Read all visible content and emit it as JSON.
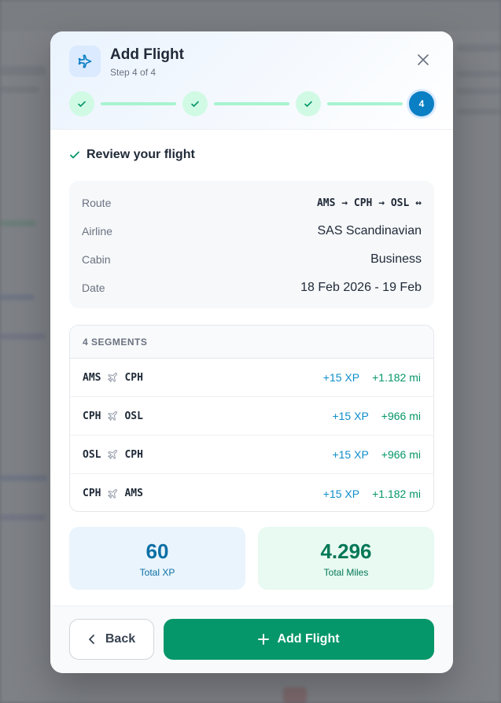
{
  "colors": {
    "accent": "#0b7fc4",
    "success": "#059669",
    "xp": "#0e8ec9"
  },
  "modal": {
    "title": "Add Flight",
    "step_label": "Step 4 of 4",
    "current_step": "4"
  },
  "review": {
    "heading": "Review your flight",
    "route_label": "Route",
    "route_value": "AMS → CPH → OSL ↔",
    "airline_label": "Airline",
    "airline_value": "SAS Scandinavian",
    "cabin_label": "Cabin",
    "cabin_value": "Business",
    "date_label": "Date",
    "date_value": "18 Feb 2026 - 19 Feb"
  },
  "segments": {
    "header": "4 SEGMENTS",
    "rows": [
      {
        "from": "AMS",
        "to": "CPH",
        "xp": "+15 XP",
        "miles": "+1.182 mi"
      },
      {
        "from": "CPH",
        "to": "OSL",
        "xp": "+15 XP",
        "miles": "+966 mi"
      },
      {
        "from": "OSL",
        "to": "CPH",
        "xp": "+15 XP",
        "miles": "+966 mi"
      },
      {
        "from": "CPH",
        "to": "AMS",
        "xp": "+15 XP",
        "miles": "+1.182 mi"
      }
    ]
  },
  "totals": {
    "xp_value": "60",
    "xp_label": "Total XP",
    "miles_value": "4.296",
    "miles_label": "Total Miles"
  },
  "footer": {
    "back_label": "Back",
    "add_label": "Add Flight"
  }
}
